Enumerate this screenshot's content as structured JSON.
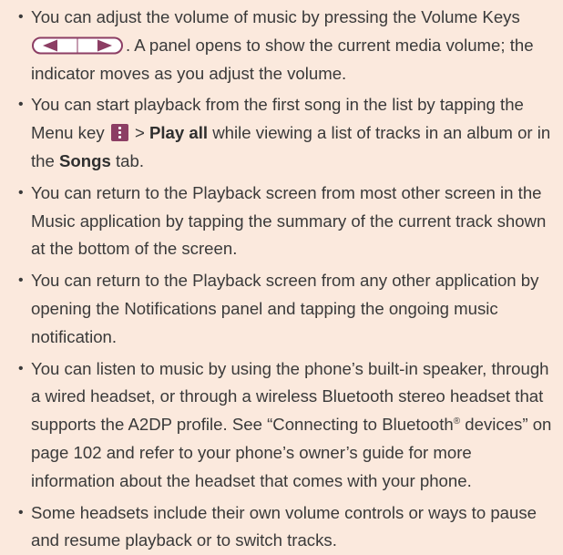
{
  "tips": [
    {
      "t1": "You can adjust the volume of music by pressing the Volume Keys ",
      "icon": "volume-keys-icon",
      "t2": ". A panel opens to show the current media volume; the indicator moves as you adjust the volume."
    },
    {
      "t1": "You can start playback from the first song in the list by tapping the Menu key ",
      "icon": "menu-key-icon",
      "t2": " > ",
      "bold1": "Play all",
      "t3": " while viewing a list of tracks in an album or in the ",
      "bold2": "Songs",
      "t4": " tab."
    },
    {
      "text": "You can return to the Playback screen from most other screen in the Music application by tapping the summary of the current track shown at the bottom of the screen."
    },
    {
      "text": "You can return to the Playback screen from any other application by opening the Notifications panel and tapping the ongoing music notification."
    },
    {
      "t1": "You can listen to music by using the phone’s built-in speaker, through a wired headset, or through a wireless Bluetooth stereo headset that supports the A2DP profile. See “Connecting to Bluetooth",
      "sup": "®",
      "t2": " devices” on page 102 and refer to your phone’s owner’s guide for more information about the headset that comes with your phone."
    },
    {
      "text": "Some headsets include their own volume controls or ways to pause and resume playback or to switch tracks."
    }
  ],
  "colors": {
    "background": "#fbe9dd",
    "text": "#3a3a3a",
    "menu_key": "#8c3e64",
    "volume_keys_stroke": "#8c3e64"
  }
}
